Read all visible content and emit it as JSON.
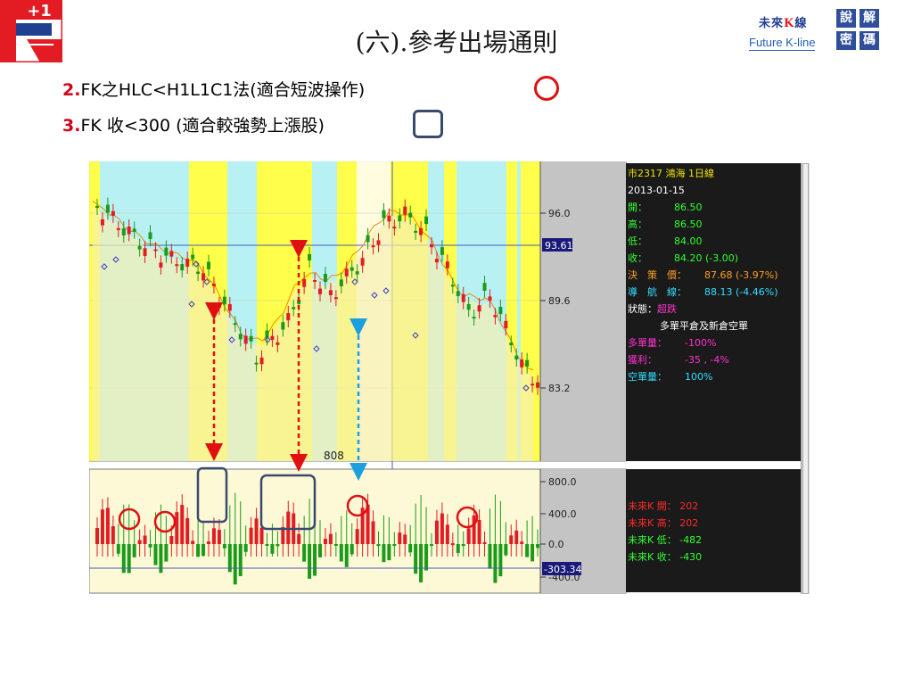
{
  "header": {
    "title": "(六).參考出場通則",
    "brand_cn_a": "未來",
    "brand_cn_k": "K",
    "brand_cn_b": "線",
    "brand_en": "Future K-line",
    "tiles": [
      "說",
      "解",
      "密",
      "碼"
    ],
    "logo_text": "+1"
  },
  "rules": {
    "rule2_num": "2.",
    "rule2_text": "FK之HLC<H1L1C1法(適合短波操作)",
    "rule3_num": "3.",
    "rule3_text": "FK 收<300 (適合較強勢上漲股)"
  },
  "chart": {
    "price_ticks": [
      "96.0",
      "89.6",
      "83.2"
    ],
    "price_current": "93.61",
    "osc_ticks": [
      "800.0",
      "400.0",
      "0.0",
      "-400.0"
    ],
    "osc_current": "-303.34",
    "annotation_808": "808",
    "colors": {
      "yellow_band": "#ffff33",
      "cyan_band": "#b3f0f5",
      "bg": "#fdf8d6",
      "up": "#e31b23",
      "down": "#1a9c1a"
    }
  },
  "info": {
    "title": "市2317 鴻海  1日線",
    "date": "2013-01-15",
    "open_label": "開：",
    "open_value": "86.50",
    "high_label": "高：",
    "high_value": "86.50",
    "low_label": "低：",
    "low_value": "84.00",
    "close_label": "收：",
    "close_value": "84.20  (-3.00)",
    "decision_label": "決　策　價：",
    "decision_value": "87.68 (-3.97%)",
    "nav_label": "導　航　線：",
    "nav_value": "88.13 (-4.46%)",
    "state_label": "狀態：",
    "state_value": "超跌",
    "state_note": "多單平倉及新倉空單",
    "long_label": "多單量：",
    "long_value": "-100%",
    "profit_label": "獲利：",
    "profit_value": "-35 , -4%",
    "short_label": "空單量：",
    "short_value": "100%"
  },
  "info2": {
    "fk_open_label": "未來K 開：",
    "fk_open_value": "202",
    "fk_high_label": "未來K 高：",
    "fk_high_value": "202",
    "fk_low_label": "未來K 低：",
    "fk_low_value": "-482",
    "fk_close_label": "未來K 收：",
    "fk_close_value": "-430"
  }
}
